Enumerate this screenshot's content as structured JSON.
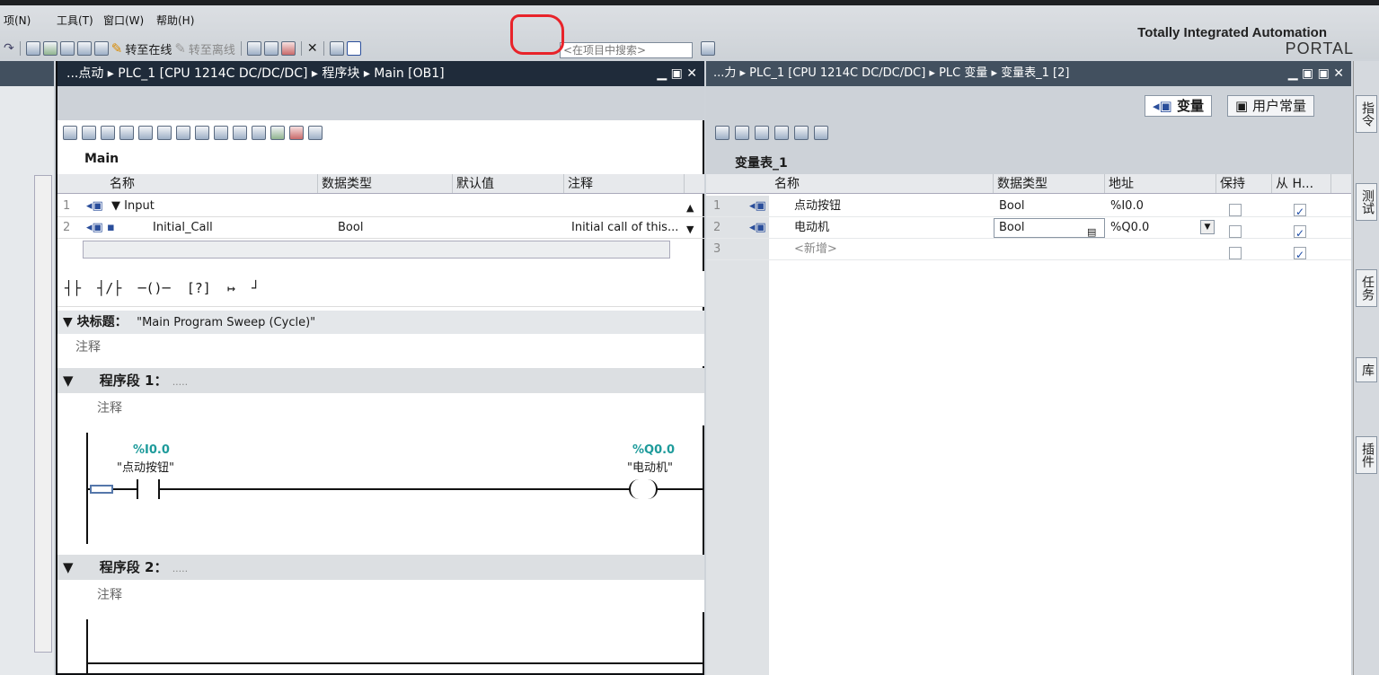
{
  "menu": {
    "items": [
      "项(N)",
      "工具(T)",
      "窗口(W)",
      "帮助(H)"
    ]
  },
  "toolbar": {
    "go_online": "转至在线",
    "go_offline": "转至离线",
    "search_placeholder": "<在项目中搜索>"
  },
  "brand": {
    "line1": "Totally Integrated Automation",
    "line2": "PORTAL"
  },
  "editor": {
    "breadcrumb": "...点动 ▸ PLC_1 [CPU 1214C DC/DC/DC] ▸ 程序块 ▸ Main [OB1]",
    "block_name": "Main",
    "interface_headers": {
      "name": "名称",
      "datatype": "数据类型",
      "default": "默认值",
      "comment": "注释"
    },
    "interface_rows": [
      {
        "num": "1",
        "name": "▼ Input",
        "datatype": "",
        "comment": ""
      },
      {
        "num": "2",
        "name": "Initial_Call",
        "datatype": "Bool",
        "comment": "Initial call of this..."
      }
    ],
    "block_title_label": "▼ 块标题：",
    "block_title": "\"Main Program Sweep (Cycle)\"",
    "comment_label": "注释",
    "network1": "程序段 1：",
    "network1_dots": ".....",
    "network2": "程序段 2：",
    "network2_dots": ".....",
    "contact_addr": "%I0.0",
    "contact_name": "\"点动按钮\"",
    "coil_addr": "%Q0.0",
    "coil_name": "\"电动机\""
  },
  "vartable": {
    "breadcrumb": "...力 ▸ PLC_1 [CPU 1214C DC/DC/DC] ▸ PLC 变量 ▸ 变量表_1 [2]",
    "tab_vars": "变量",
    "tab_consts": "用户常量",
    "table_name": "变量表_1",
    "headers": {
      "name": "名称",
      "datatype": "数据类型",
      "address": "地址",
      "retain": "保持",
      "from_hmi": "从 H..."
    },
    "rows": [
      {
        "num": "1",
        "name": "点动按钮",
        "datatype": "Bool",
        "address": "%I0.0"
      },
      {
        "num": "2",
        "name": "电动机",
        "datatype": "Bool",
        "address": "%Q0.0"
      },
      {
        "num": "3",
        "name": "<新增>",
        "datatype": "",
        "address": ""
      }
    ]
  },
  "side_tabs": [
    "指令",
    "测试",
    "任务",
    "库",
    "插件"
  ]
}
